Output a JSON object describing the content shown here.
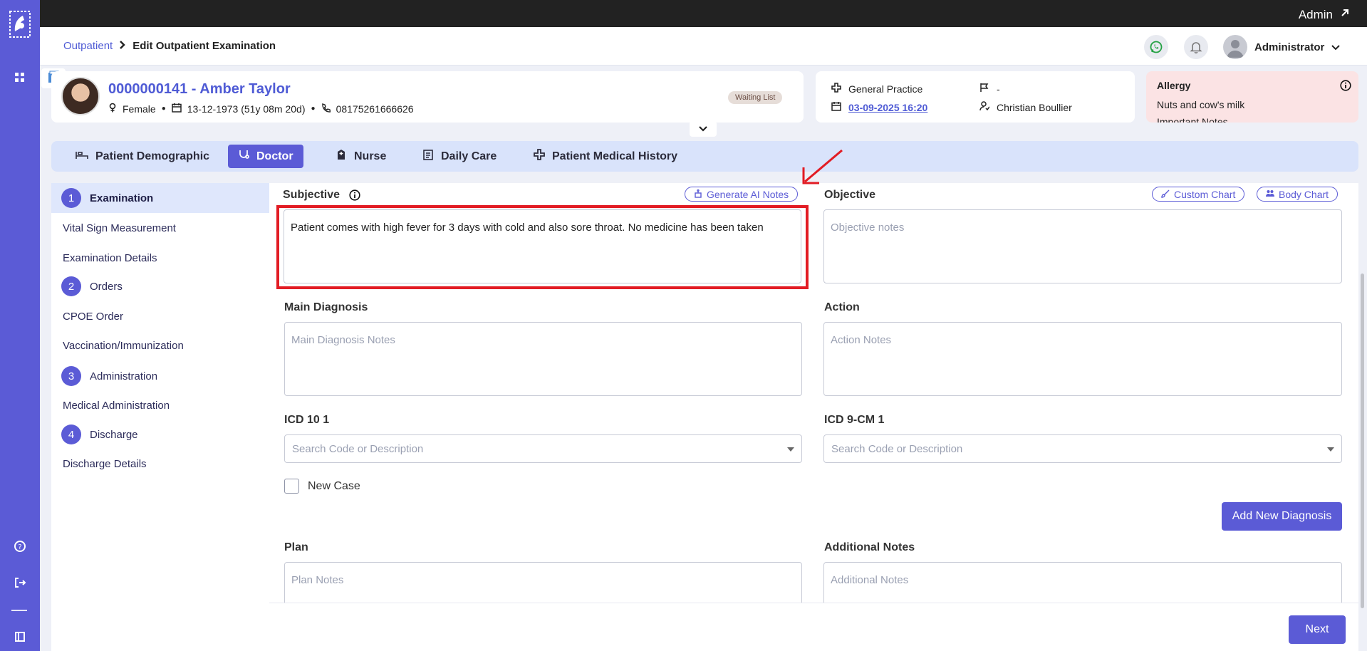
{
  "topbar": {
    "user_label": "Admin"
  },
  "header": {
    "breadcrumb_root": "Outpatient",
    "breadcrumb_current": "Edit Outpatient Examination",
    "user_name": "Administrator"
  },
  "patient": {
    "name": "0000000141 - Amber Taylor",
    "gender": "Female",
    "dob": "13-12-1973 (51y 08m 20d)",
    "phone": "08175261666626",
    "status": "Waiting List"
  },
  "visit": {
    "department": "General Practice",
    "date": "03-09-2025 16:20",
    "priority": "-",
    "doctor": "Christian Boullier"
  },
  "allergy": {
    "title": "Allergy",
    "value": "Nuts and cow's milk",
    "next_line": "Important Notes"
  },
  "tabs": [
    {
      "label": "Patient Demographic"
    },
    {
      "label": "Doctor"
    },
    {
      "label": "Nurse"
    },
    {
      "label": "Daily Care"
    },
    {
      "label": "Patient Medical History"
    }
  ],
  "steps": {
    "s1": {
      "num": "1",
      "label": "Examination"
    },
    "s1_items": [
      "Vital Sign Measurement",
      "Examination Details"
    ],
    "s2": {
      "num": "2",
      "label": "Orders"
    },
    "s2_items": [
      "CPOE Order",
      "Vaccination/Immunization"
    ],
    "s3": {
      "num": "3",
      "label": "Administration"
    },
    "s3_items": [
      "Medical Administration"
    ],
    "s4": {
      "num": "4",
      "label": "Discharge"
    },
    "s4_items": [
      "Discharge Details"
    ]
  },
  "form": {
    "subjective_label": "Subjective",
    "subjective_value": "Patient comes with high fever for 3 days with cold and also sore throat. No medicine has been taken",
    "generate_ai": "Generate AI Notes",
    "objective_label": "Objective",
    "objective_placeholder": "Objective notes",
    "custom_chart": "Custom Chart",
    "body_chart": "Body Chart",
    "main_diagnosis_label": "Main Diagnosis",
    "main_diagnosis_placeholder": "Main Diagnosis Notes",
    "action_label": "Action",
    "action_placeholder": "Action Notes",
    "icd10_label": "ICD 10 1",
    "icd10_placeholder": "Search Code or Description",
    "icd9_label": "ICD 9-CM 1",
    "icd9_placeholder": "Search Code or Description",
    "new_case": "New Case",
    "add_diagnosis": "Add New Diagnosis",
    "plan_label": "Plan",
    "plan_placeholder": "Plan Notes",
    "additional_label": "Additional Notes",
    "additional_placeholder": "Additional Notes",
    "next": "Next"
  },
  "colors": {
    "accent": "#5b5bd6",
    "highlight": "#e21c24",
    "allergy_bg": "#fbe3e4"
  }
}
